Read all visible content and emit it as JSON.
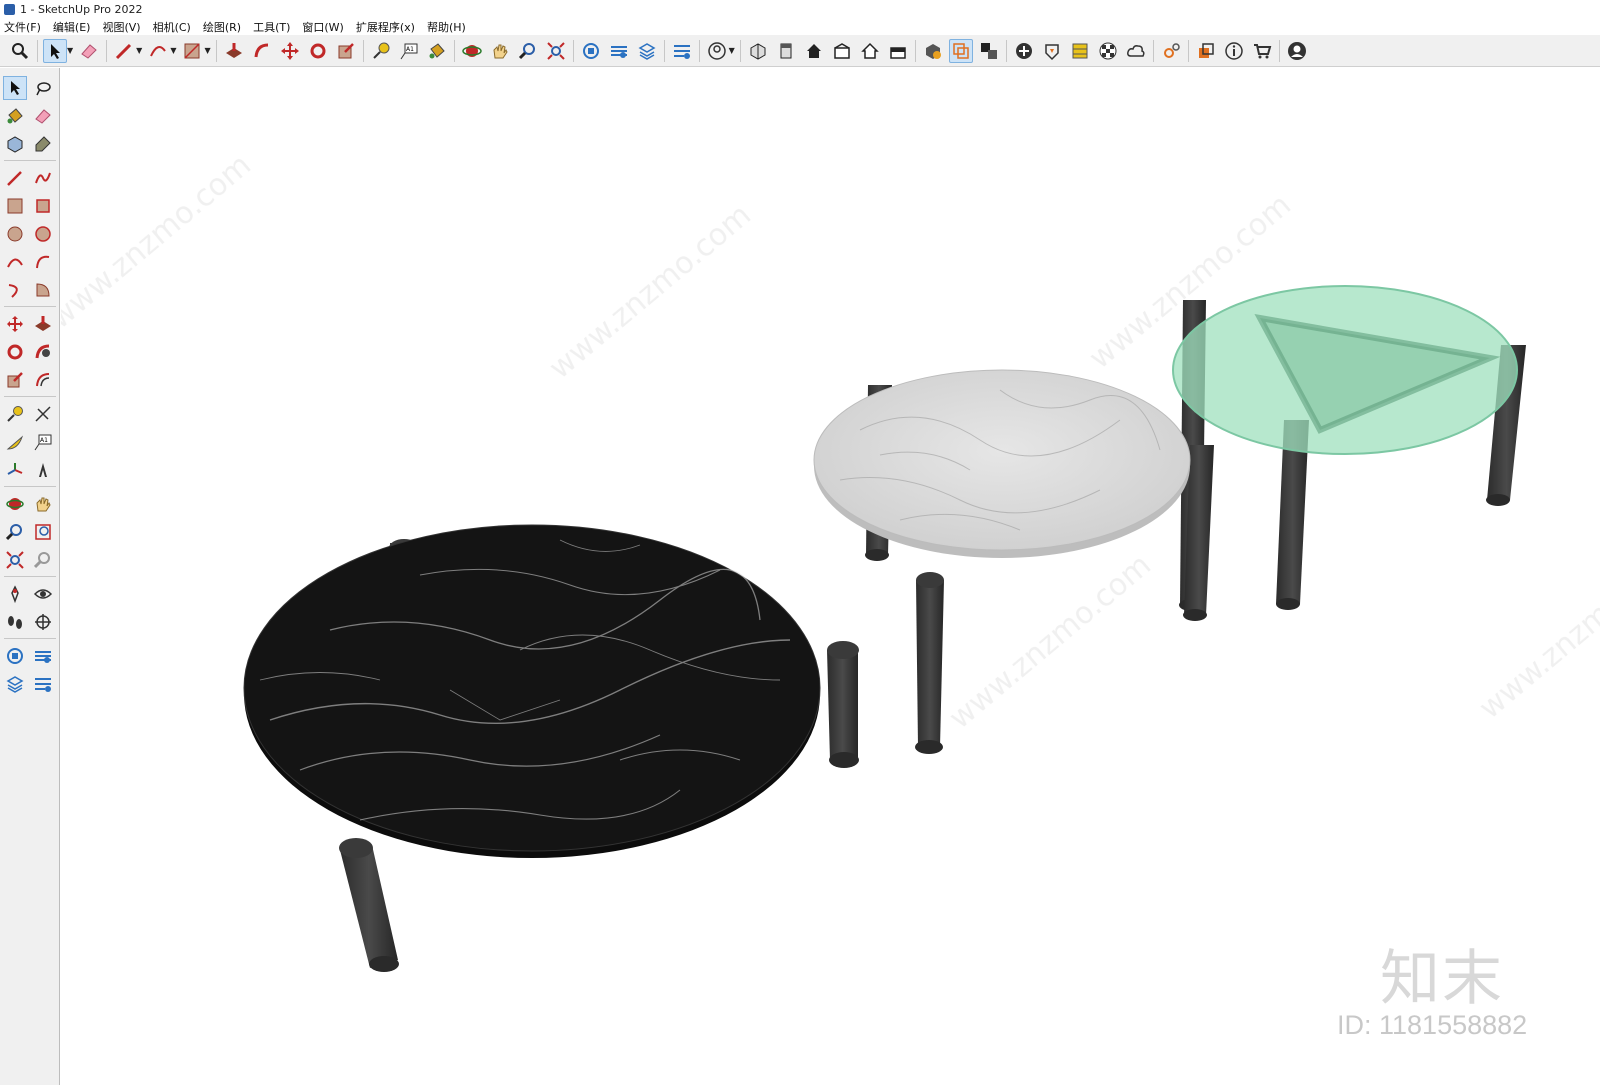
{
  "window": {
    "title": "1 - SketchUp Pro 2022"
  },
  "menu": [
    "文件(F)",
    "编辑(E)",
    "视图(V)",
    "相机(C)",
    "绘图(R)",
    "工具(T)",
    "窗口(W)",
    "扩展程序(x)",
    "帮助(H)"
  ],
  "toolbar_icons": [
    "zoom-icon",
    "select-icon",
    "eraser-icon",
    "pencil-icon",
    "arc-icon",
    "rectangle-icon",
    "push-pull-icon",
    "follow-me-icon",
    "move-icon",
    "rotate-icon",
    "scale-icon",
    "tape-measure-icon",
    "text-icon",
    "paint-bucket-icon",
    "orbit-icon",
    "pan-icon",
    "zoom-window-icon",
    "zoom-extents-icon",
    "3d-warehouse-icon",
    "extension-warehouse-icon",
    "layout-icon",
    "styles-icon",
    "user-icon",
    "iso-view-icon",
    "top-view-icon",
    "front-view-icon",
    "right-view-icon",
    "back-view-icon",
    "left-view-icon",
    "solid-tools-icon",
    "section-plane-icon",
    "display-section-icon",
    "add-location-icon",
    "sandbox-icon",
    "material-icon",
    "texture-icon",
    "cloud-icon",
    "settings-icon",
    "scenes-icon",
    "info-icon",
    "cart-icon",
    "account-icon"
  ],
  "colors": {
    "toolbar_bg": "#f0f0f0",
    "selection_blue": "#cde3f7",
    "black_marble": "#141414",
    "white_marble": "#d9d9d9",
    "glass": "#9fe0bd",
    "leg": "#3a3a3a"
  },
  "watermark": {
    "brand": "知末",
    "id": "ID: 1181558882",
    "site": "www.znzmo.com"
  }
}
